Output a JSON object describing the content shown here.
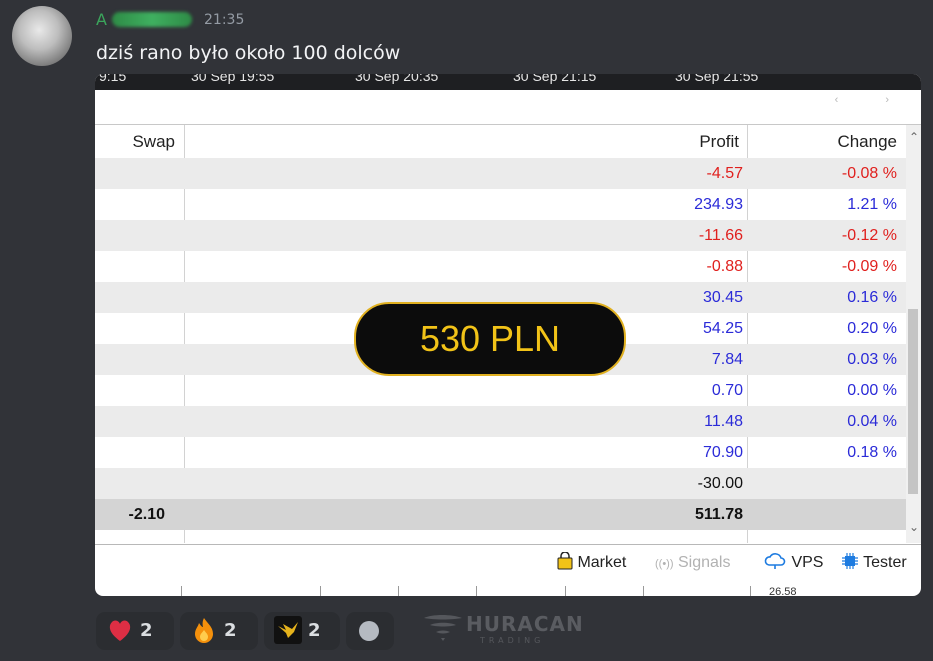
{
  "message": {
    "author_initial": "A",
    "time": "21:35",
    "text": "dziś rano było około 100 dolców"
  },
  "terminal": {
    "axis_labels": [
      "9:15",
      "30 Sep 19:55",
      "30 Sep 20:35",
      "30 Sep 21:15",
      "30 Sep 21:55"
    ],
    "nav_arrows": "‹ ›",
    "columns": {
      "swap": "Swap",
      "profit": "Profit",
      "change": "Change"
    },
    "rows": [
      {
        "profit": "-4.57",
        "change": "-0.08 %",
        "tone": "neg"
      },
      {
        "profit": "234.93",
        "change": "1.21 %",
        "tone": "pos"
      },
      {
        "profit": "-11.66",
        "change": "-0.12 %",
        "tone": "neg"
      },
      {
        "profit": "-0.88",
        "change": "-0.09 %",
        "tone": "neg"
      },
      {
        "profit": "30.45",
        "change": "0.16 %",
        "tone": "pos"
      },
      {
        "profit": "54.25",
        "change": "0.20 %",
        "tone": "pos"
      },
      {
        "profit": "7.84",
        "change": "0.03 %",
        "tone": "pos"
      },
      {
        "profit": "0.70",
        "change": "0.00 %",
        "tone": "pos"
      },
      {
        "profit": "11.48",
        "change": "0.04 %",
        "tone": "pos"
      },
      {
        "profit": "70.90",
        "change": "0.18 %",
        "tone": "pos"
      },
      {
        "profit": "-30.00",
        "change": "",
        "tone": "neu"
      }
    ],
    "total": {
      "swap": "-2.10",
      "profit": "511.78"
    },
    "overlay_badge": "530 PLN",
    "bottom_tabs": {
      "market": "Market",
      "signals": "Signals",
      "vps": "VPS",
      "tester": "Tester"
    },
    "bottom_partial": "26.58"
  },
  "reactions": [
    {
      "emoji": "heart-icon",
      "count": "2"
    },
    {
      "emoji": "fire-icon",
      "count": "2"
    },
    {
      "emoji": "custom-emoji-icon",
      "count": "2"
    }
  ],
  "watermark": {
    "brand": "HURACAN",
    "sub": "TRADING"
  },
  "colors": {
    "negative": "#e0201e",
    "positive": "#2b2bd8",
    "badge_text": "#f2c318",
    "author": "#3ba55c"
  }
}
